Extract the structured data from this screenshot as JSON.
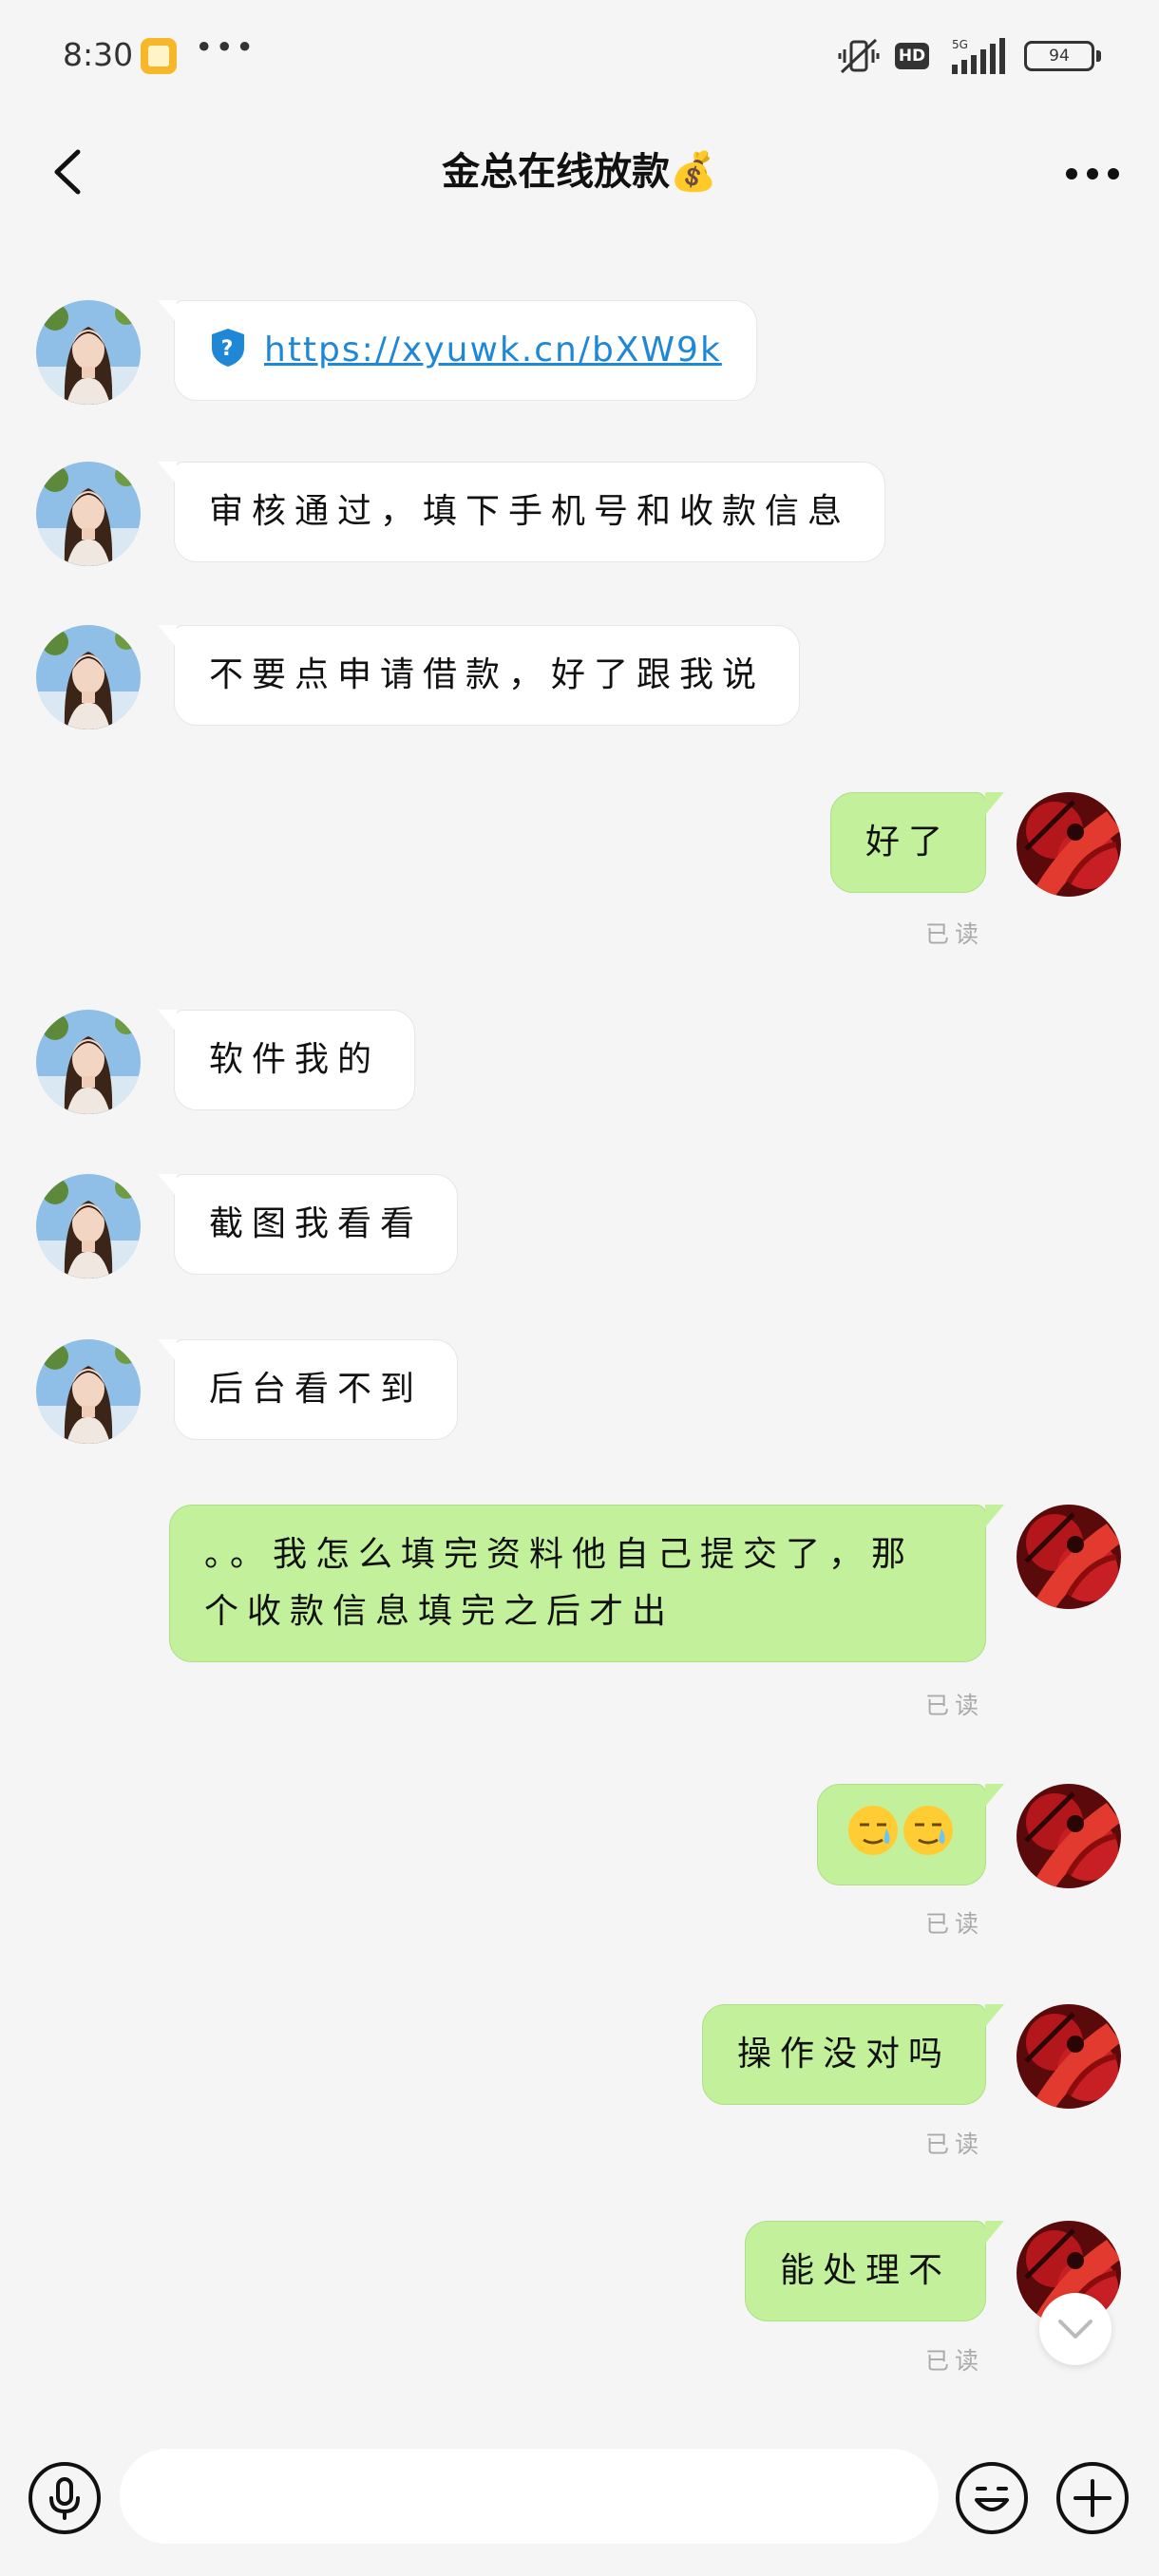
{
  "status_bar": {
    "time": "8:30",
    "more": "•••",
    "hd": "HD",
    "network": "5G",
    "battery": "94"
  },
  "header": {
    "title": "金总在线放款💰",
    "back_icon": "chevron-left-icon",
    "more_icon": "more-horizontal-icon"
  },
  "messages": [
    {
      "from": "contact",
      "type": "link",
      "text": "https://xyuwk.cn/bXW9k"
    },
    {
      "from": "contact",
      "text": "审核通过，填下手机号和收款信息"
    },
    {
      "from": "contact",
      "text": "不要点申请借款，好了跟我说"
    },
    {
      "from": "me",
      "text": "好了",
      "read": "已读"
    },
    {
      "from": "contact",
      "text": "软件我的"
    },
    {
      "from": "contact",
      "text": "截图我看看"
    },
    {
      "from": "contact",
      "text": "后台看不到"
    },
    {
      "from": "me",
      "text": "。。我怎么填完资料他自己提交了，那个收款信息填完之后才出",
      "read": "已读"
    },
    {
      "from": "me",
      "type": "emoji",
      "emoji": "sweat-smile-icon x2",
      "read": "已读"
    },
    {
      "from": "me",
      "text": "操作没对吗",
      "read": "已读"
    },
    {
      "from": "me",
      "text": "能处理不",
      "read": "已读"
    }
  ],
  "colors": {
    "outgoing_bubble": "#c3f19b",
    "incoming_bubble": "#ffffff",
    "link": "#1f88d6",
    "background": "#f5f5f5"
  },
  "input_bar": {
    "voice_icon": "microphone-icon",
    "emoji_icon": "smiley-icon",
    "plus_icon": "plus-circle-icon",
    "placeholder": ""
  }
}
